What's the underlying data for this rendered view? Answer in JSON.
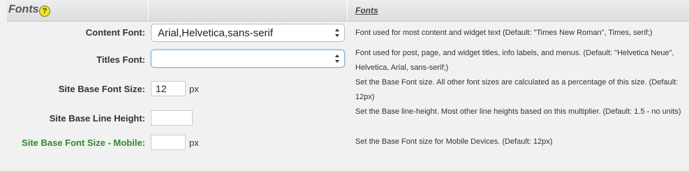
{
  "section": {
    "title": "Fonts",
    "help_icon": "?",
    "help_heading": "Fonts"
  },
  "rows": [
    {
      "label": "Content Font:",
      "value": "Arial,Helvetica,sans-serif",
      "description": "Font used for most content and widget text (Default: \"Times New Roman\", Times, serif;)"
    },
    {
      "label": "Titles Font:",
      "value": "",
      "description": "Font used for post, page, and widget titles, info labels, and menus. (Default: \"Helvetica Neue\", Helvetica, Arial, sans-serif;)"
    },
    {
      "label": "Site Base Font Size:",
      "value": "12",
      "unit": "px",
      "description": "Set the Base Font size. All other font sizes are calculated as a percentage of this size. (Default: 12px)"
    },
    {
      "label": "Site Base Line Height:",
      "value": "",
      "description": "Set the Base line-height. Most other line heights based on this multiplier. (Default: 1.5 - no units)"
    },
    {
      "label": "Site Base Font Size - Mobile:",
      "value": "",
      "unit": "px",
      "description": "Set the Base Font size for Mobile Devices. (Default: 12px)"
    }
  ],
  "colors": {
    "mobile_label": "#2c8a2c",
    "background": "#f1f1f1"
  }
}
